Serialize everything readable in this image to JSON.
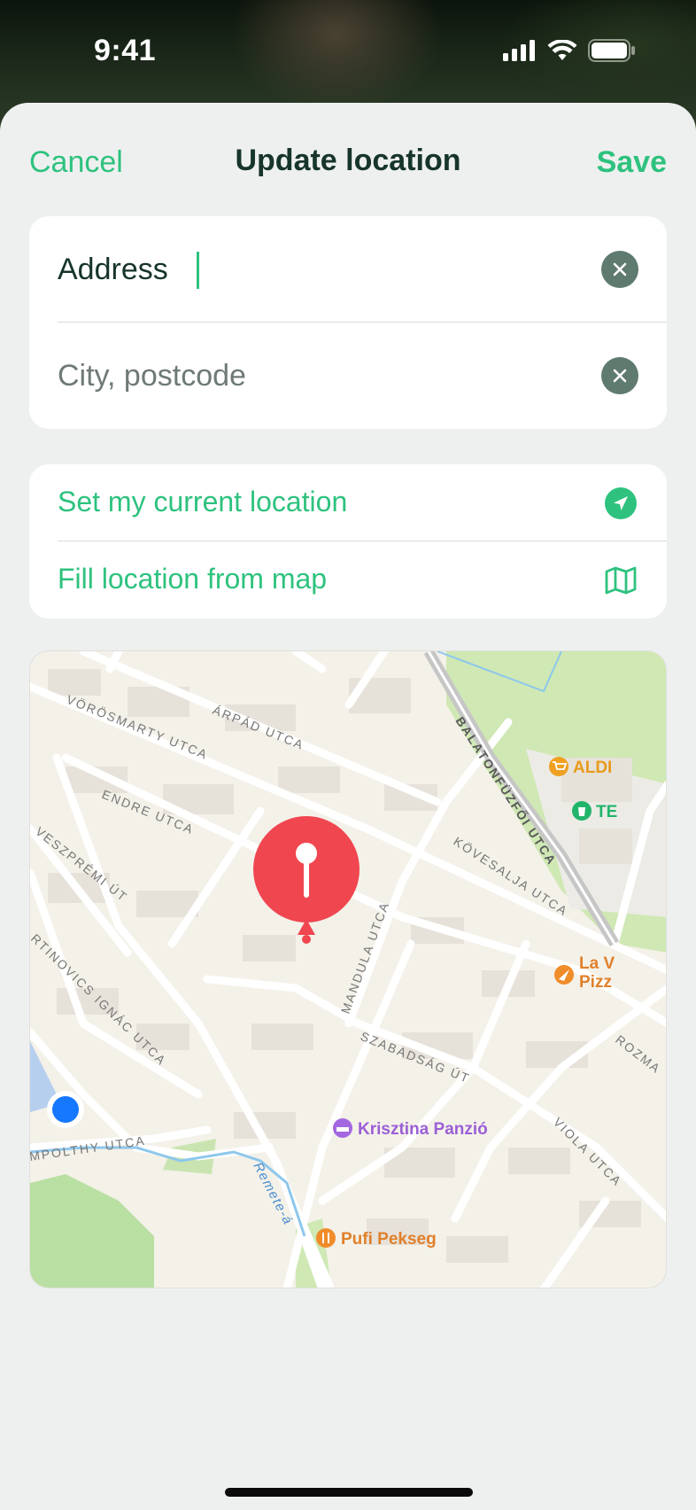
{
  "status_bar": {
    "time": "9:41"
  },
  "nav": {
    "cancel": "Cancel",
    "title": "Update location",
    "save": "Save"
  },
  "address_form": {
    "address": {
      "value": "Address",
      "placeholder": "Address"
    },
    "city": {
      "value": "",
      "placeholder": "City, postcode"
    }
  },
  "actions": {
    "current_location": {
      "label": "Set my current location",
      "icon": "location-arrow-icon"
    },
    "from_map": {
      "label": "Fill location from map",
      "icon": "map-icon"
    }
  },
  "map": {
    "streets": [
      "VÖRÖSMARTY UTCA",
      "ÁRPÁD UTCA",
      "ENDRE UTCA",
      "VESZPRÉMI ÚT",
      "BALATONFÜZFŐI UTCA",
      "KÖVESALJA UTCA",
      "MANDULA UTCA",
      "RTINOVICS IGNÁC UTCA",
      "SZABADSÁG ÚT",
      "ROZMA",
      "VIOLA UTCA",
      "MPOLTHY UTCA",
      "Remete-á"
    ],
    "pois": [
      {
        "name": "ALDI",
        "icon": "shopping-cart-icon",
        "color": "#f0a020"
      },
      {
        "name": "TE",
        "icon": "shop-icon",
        "color": "#21b56b"
      },
      {
        "name": "La V",
        "name2": "Pizz",
        "icon": "pizza-icon",
        "color": "#f08c2a"
      },
      {
        "name": "Krisztina Panzió",
        "icon": "bed-icon",
        "color": "#a368e0"
      },
      {
        "name": "Pufi Pekseg",
        "icon": "fork-knife-icon",
        "color": "#f08c2a"
      }
    ]
  },
  "colors": {
    "accent": "#2ec27e",
    "pin": "#f04650",
    "title": "#17352a",
    "user_dot": "#1677ff"
  }
}
